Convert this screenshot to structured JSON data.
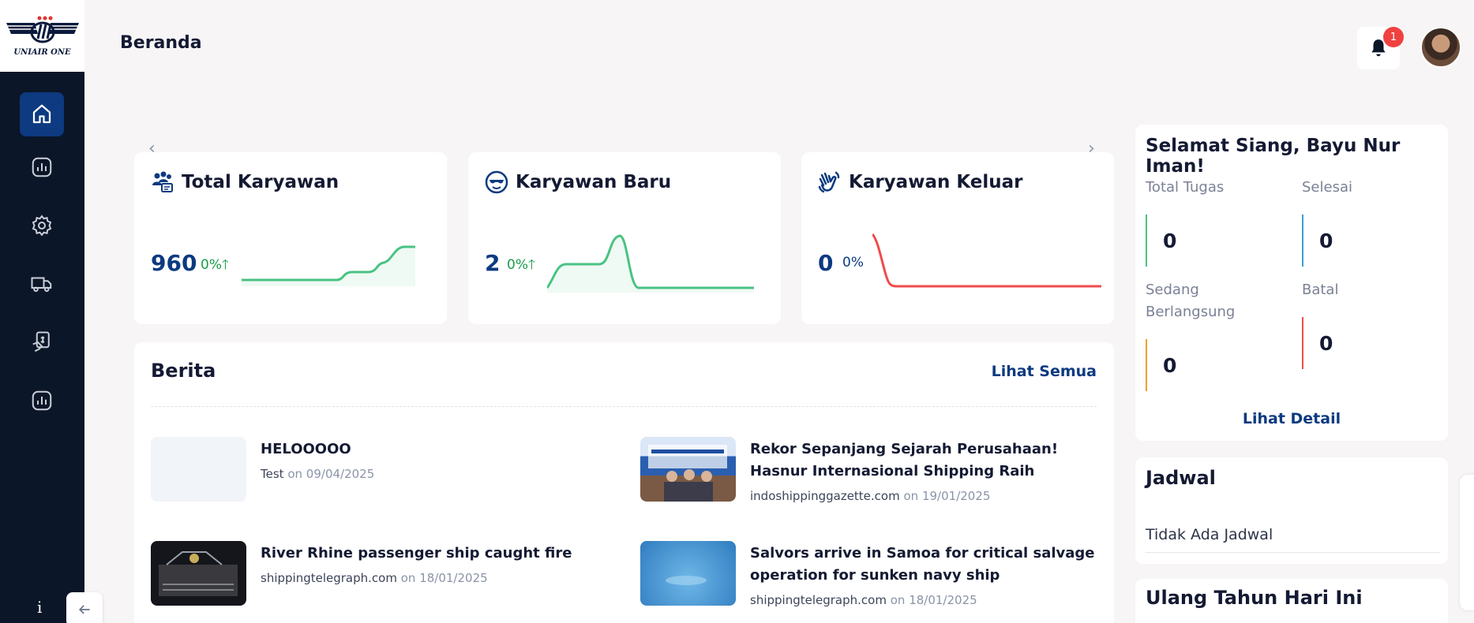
{
  "brand": {
    "name": "UNIAIR ONE"
  },
  "header": {
    "title": "Beranda",
    "notification_count": "1"
  },
  "sidebar": {
    "items": [
      {
        "icon": "home-icon",
        "active": true
      },
      {
        "icon": "chart-icon"
      },
      {
        "icon": "gear-icon"
      },
      {
        "icon": "truck-icon"
      },
      {
        "icon": "money-hand-icon"
      },
      {
        "icon": "chart-icon"
      }
    ],
    "info": "i"
  },
  "stats": [
    {
      "title": "Total Karyawan",
      "value": "960",
      "pct": "0%",
      "trend": "up",
      "color": "#1a9a4a",
      "icon": "users-icon"
    },
    {
      "title": "Karyawan Baru",
      "value": "2",
      "pct": "0%",
      "trend": "up",
      "color": "#1a9a4a",
      "icon": "cool-face-icon"
    },
    {
      "title": "Karyawan Keluar",
      "value": "0",
      "pct": "0%",
      "trend": "none",
      "color": "#0d3a80",
      "icon": "waving-hand-icon"
    }
  ],
  "news": {
    "heading": "Berita",
    "see_all": "Lihat Semua",
    "items": [
      {
        "title": "HELOOOOO",
        "source": "Test",
        "on": "on",
        "date": "09/04/2025"
      },
      {
        "title": "Rekor Sepanjang Sejarah Perusahaan! Hasnur Internasional Shipping Raih Pendapatan...",
        "source": "indoshippinggazette.com",
        "on": "on",
        "date": "19/01/2025"
      },
      {
        "title": "River Rhine passenger ship caught fire",
        "source": "shippingtelegraph.com",
        "on": "on",
        "date": "18/01/2025"
      },
      {
        "title": "Salvors arrive in Samoa for critical salvage operation for sunken navy ship",
        "source": "shippingtelegraph.com",
        "on": "on",
        "date": "18/01/2025"
      }
    ]
  },
  "summary": {
    "greeting": "Selamat Siang, Bayu Nur Iman!",
    "total_label": "Total Tugas",
    "total_value": "0",
    "done_label": "Selesai",
    "done_value": "0",
    "ongoing_label_1": "Sedang",
    "ongoing_label_2": "Berlangsung",
    "ongoing_value": "0",
    "cancel_label": "Batal",
    "cancel_value": "0",
    "detail": "Lihat Detail"
  },
  "schedule": {
    "heading": "Jadwal",
    "empty": "Tidak Ada Jadwal"
  },
  "birthday": {
    "heading": "Ulang Tahun Hari Ini"
  },
  "colors": {
    "sidebar": "#0b1628",
    "accent": "#0d3a80",
    "up": "#4ac283",
    "down": "#f04b4b"
  }
}
